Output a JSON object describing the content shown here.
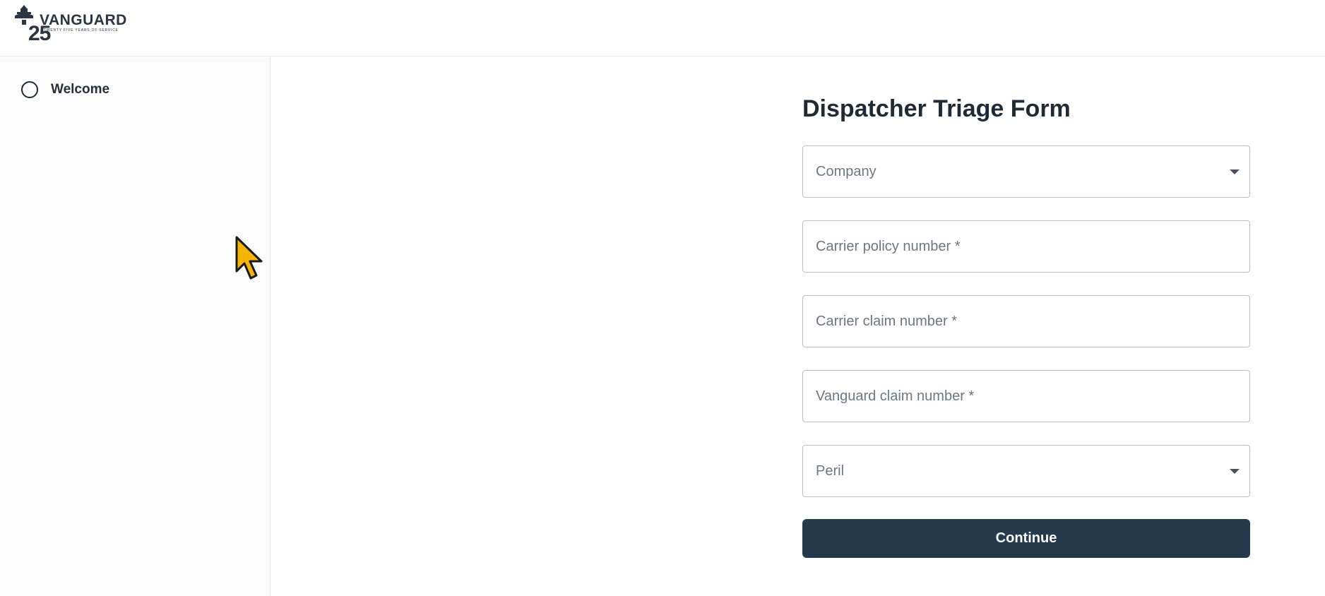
{
  "brand": {
    "name": "VANGUARD",
    "anniversary": "25",
    "tagline": "TWENTY FIVE YEARS OF SERVICE"
  },
  "sidebar": {
    "items": [
      {
        "label": "Welcome",
        "icon": "radio-circle-icon"
      }
    ]
  },
  "form": {
    "title": "Dispatcher Triage Form",
    "fields": [
      {
        "type": "select",
        "label": "Company"
      },
      {
        "type": "text",
        "placeholder": "Carrier policy number *"
      },
      {
        "type": "text",
        "placeholder": "Carrier claim number *"
      },
      {
        "type": "text",
        "placeholder": "Vanguard claim number *"
      },
      {
        "type": "select",
        "label": "Peril"
      }
    ],
    "continue_label": "Continue"
  },
  "colors": {
    "primary_button": "#253a4c",
    "text_dark": "#1f2a35",
    "placeholder": "#6f767e",
    "border": "#b9bec4",
    "cursor_fill": "#f5b400"
  }
}
